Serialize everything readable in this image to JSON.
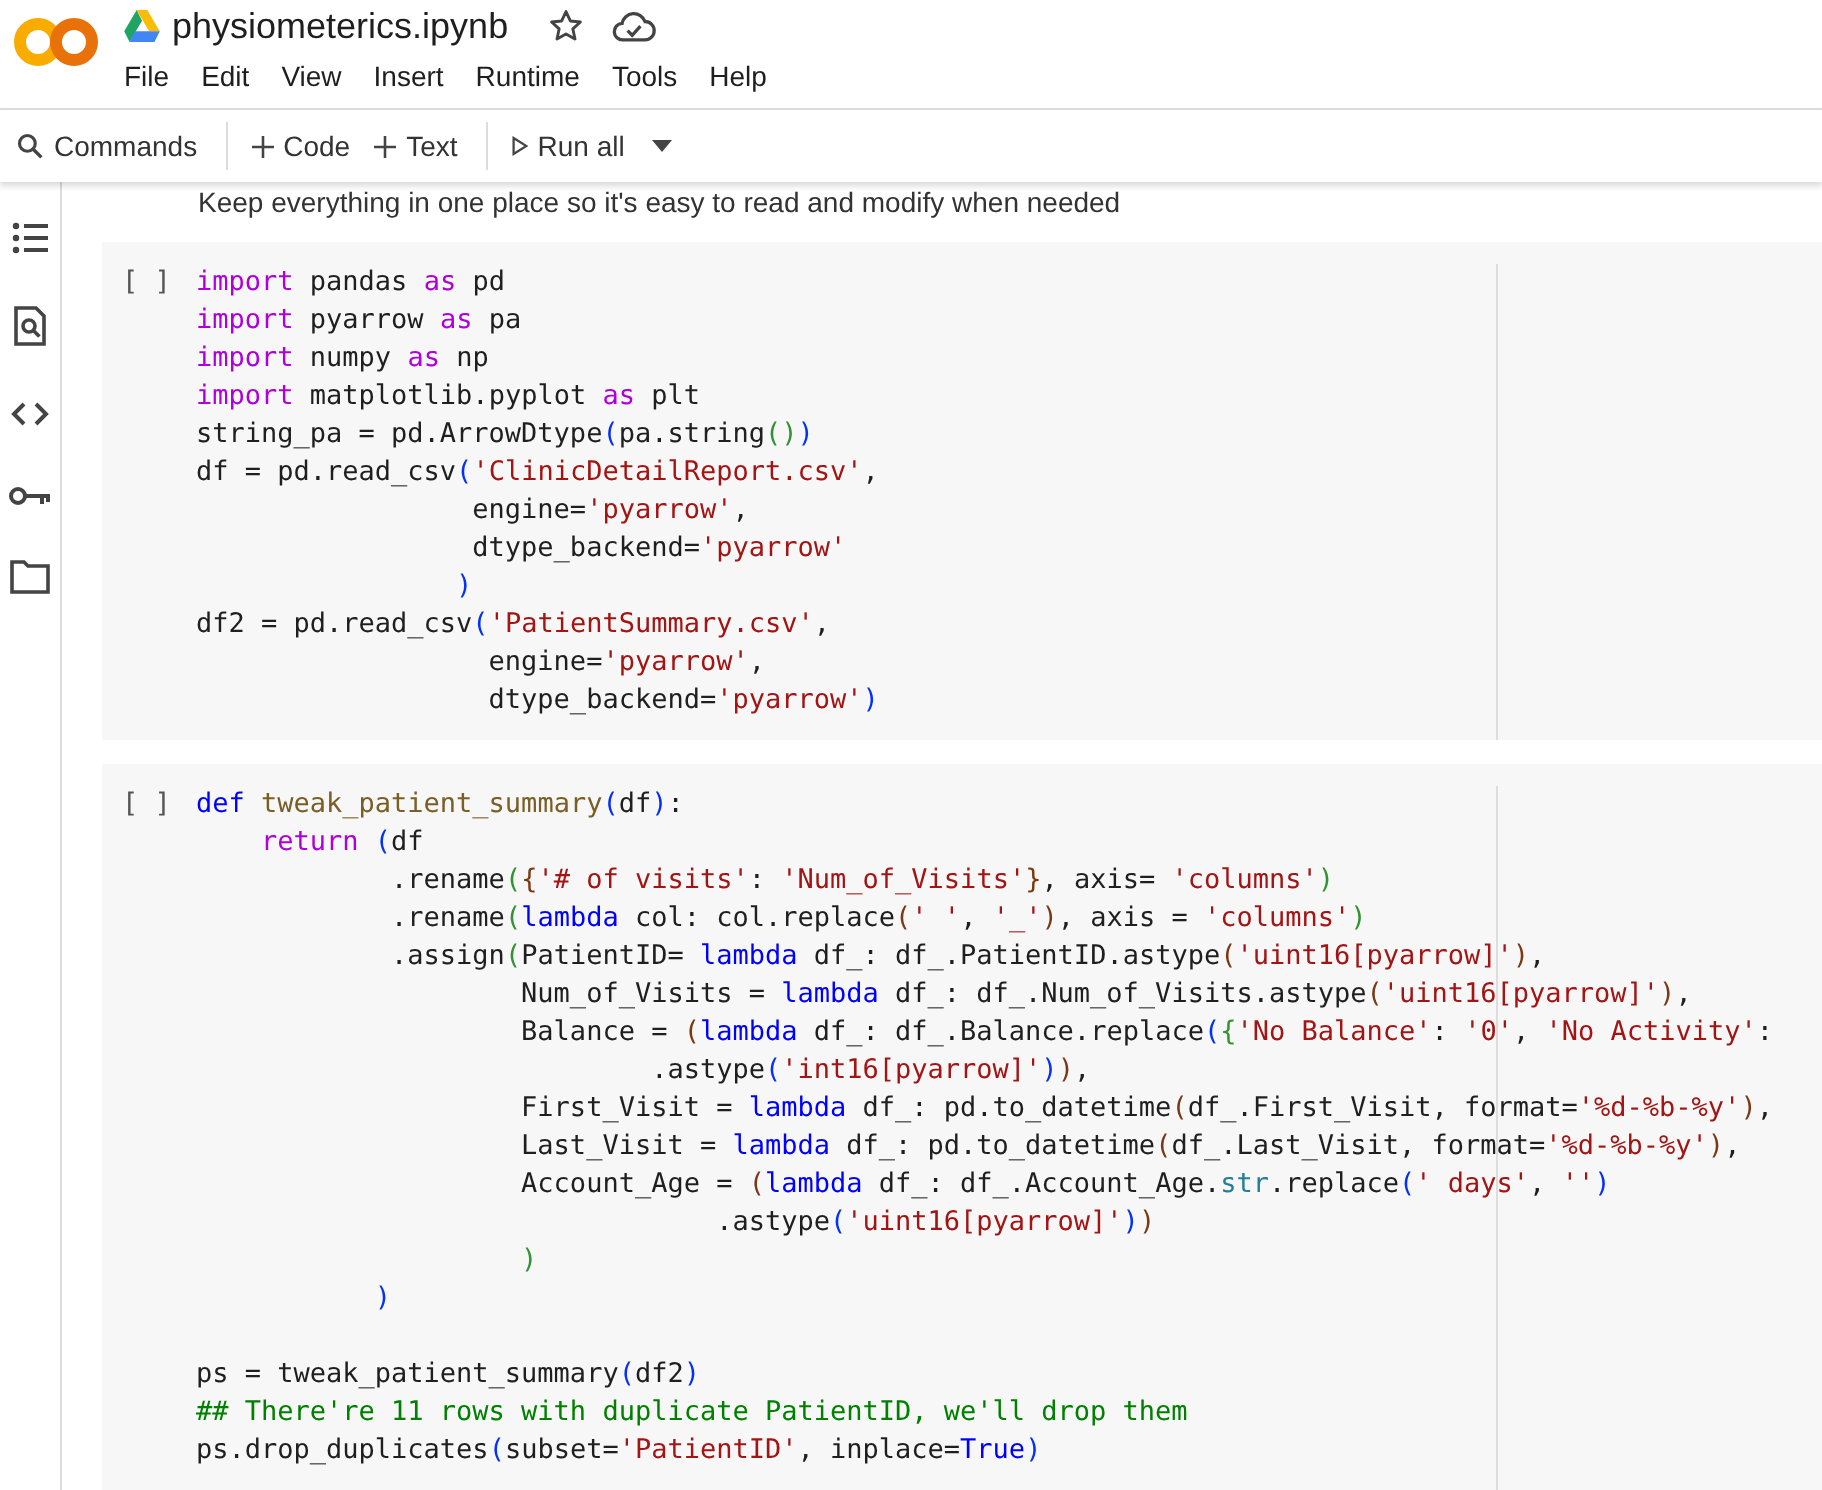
{
  "notebook": {
    "title": "physiometerics.ipynb"
  },
  "menu": [
    "File",
    "Edit",
    "View",
    "Insert",
    "Runtime",
    "Tools",
    "Help"
  ],
  "toolbar": {
    "commands": "Commands",
    "add_code": "Code",
    "add_text": "Text",
    "run_all": "Run all"
  },
  "cells": [
    {
      "kind": "text",
      "text": "Keep everything in one place so it's easy to read and modify when needed"
    },
    {
      "kind": "code",
      "gutter": "[ ]",
      "blocks": [
        [
          [
            {
              "text": "import",
              "kind": "kw"
            },
            {
              "text": " pandas ",
              "kind": "p"
            },
            {
              "text": "as",
              "kind": "kw"
            },
            {
              "text": " pd",
              "kind": "p"
            }
          ],
          [
            {
              "text": "import",
              "kind": "kw"
            },
            {
              "text": " pyarrow ",
              "kind": "p"
            },
            {
              "text": "as",
              "kind": "kw"
            },
            {
              "text": " pa",
              "kind": "p"
            }
          ],
          [
            {
              "text": "import",
              "kind": "kw"
            },
            {
              "text": " numpy ",
              "kind": "p"
            },
            {
              "text": "as",
              "kind": "kw"
            },
            {
              "text": " np",
              "kind": "p"
            }
          ],
          [
            {
              "text": "import",
              "kind": "kw"
            },
            {
              "text": " matplotlib.pyplot ",
              "kind": "p"
            },
            {
              "text": "as",
              "kind": "kw"
            },
            {
              "text": " plt",
              "kind": "p"
            }
          ],
          [
            {
              "text": "string_pa = pd.ArrowDtype",
              "kind": "p"
            },
            {
              "text": "(",
              "kind": "b1"
            },
            {
              "text": "pa.string",
              "kind": "p"
            },
            {
              "text": "()",
              "kind": "b2"
            },
            {
              "text": ")",
              "kind": "b1"
            }
          ],
          [
            {
              "text": "df = pd.read_csv",
              "kind": "p"
            },
            {
              "text": "(",
              "kind": "b1"
            },
            {
              "text": "'ClinicDetailReport.csv'",
              "kind": "s"
            },
            {
              "text": ",",
              "kind": "p"
            }
          ],
          [
            {
              "text": "                 engine=",
              "kind": "p"
            },
            {
              "text": "'pyarrow'",
              "kind": "s"
            },
            {
              "text": ",",
              "kind": "p"
            }
          ],
          [
            {
              "text": "                 dtype_backend=",
              "kind": "p"
            },
            {
              "text": "'pyarrow'",
              "kind": "s"
            }
          ],
          [
            {
              "text": "                )",
              "kind": "b1"
            }
          ],
          [
            {
              "text": "df2 = pd.read_csv",
              "kind": "p"
            },
            {
              "text": "(",
              "kind": "b1"
            },
            {
              "text": "'PatientSummary.csv'",
              "kind": "s"
            },
            {
              "text": ",",
              "kind": "p"
            }
          ],
          [
            {
              "text": "                  engine=",
              "kind": "p"
            },
            {
              "text": "'pyarrow'",
              "kind": "s"
            },
            {
              "text": ",",
              "kind": "p"
            }
          ],
          [
            {
              "text": "                  dtype_backend=",
              "kind": "p"
            },
            {
              "text": "'pyarrow'",
              "kind": "s"
            },
            {
              "text": ")",
              "kind": "b1"
            }
          ]
        ]
      ]
    },
    {
      "kind": "code",
      "gutter": "[ ]",
      "blocks": [
        [
          [
            {
              "text": "def",
              "kind": "bl"
            },
            {
              "text": " tweak_patient_summary",
              "kind": "fn"
            },
            {
              "text": "(",
              "kind": "b1"
            },
            {
              "text": "df",
              "kind": "p"
            },
            {
              "text": ")",
              "kind": "b1"
            },
            {
              "text": ":",
              "kind": "p"
            }
          ],
          [
            {
              "text": "    return",
              "kind": "kw"
            },
            {
              "text": " (",
              "kind": "b1"
            },
            {
              "text": "df",
              "kind": "p"
            }
          ],
          [
            {
              "text": "            .rename",
              "kind": "p"
            },
            {
              "text": "(",
              "kind": "b2"
            },
            {
              "text": "{",
              "kind": "b3"
            },
            {
              "text": "'# of visits'",
              "kind": "s"
            },
            {
              "text": ": ",
              "kind": "p"
            },
            {
              "text": "'Num_of_Visits'",
              "kind": "s"
            },
            {
              "text": "}",
              "kind": "b3"
            },
            {
              "text": ", axis= ",
              "kind": "p"
            },
            {
              "text": "'columns'",
              "kind": "s"
            },
            {
              "text": ")",
              "kind": "b2"
            }
          ],
          [
            {
              "text": "            .rename",
              "kind": "p"
            },
            {
              "text": "(",
              "kind": "b2"
            },
            {
              "text": "lambda",
              "kind": "bl"
            },
            {
              "text": " col: col.replace",
              "kind": "p"
            },
            {
              "text": "(",
              "kind": "b3"
            },
            {
              "text": "' '",
              "kind": "s"
            },
            {
              "text": ", ",
              "kind": "p"
            },
            {
              "text": "'_'",
              "kind": "s"
            },
            {
              "text": ")",
              "kind": "b3"
            },
            {
              "text": ", axis = ",
              "kind": "p"
            },
            {
              "text": "'columns'",
              "kind": "s"
            },
            {
              "text": ")",
              "kind": "b2"
            }
          ],
          [
            {
              "text": "            .assign",
              "kind": "p"
            },
            {
              "text": "(",
              "kind": "b2"
            },
            {
              "text": "PatientID= ",
              "kind": "p"
            },
            {
              "text": "lambda",
              "kind": "bl"
            },
            {
              "text": " df_: df_.PatientID.astype",
              "kind": "p"
            },
            {
              "text": "(",
              "kind": "b3"
            },
            {
              "text": "'uint16[pyarrow]'",
              "kind": "s"
            },
            {
              "text": ")",
              "kind": "b3"
            },
            {
              "text": ",",
              "kind": "p"
            }
          ],
          [
            {
              "text": "                    Num_of_Visits = ",
              "kind": "p"
            },
            {
              "text": "lambda",
              "kind": "bl"
            },
            {
              "text": " df_: df_.Num_of_Visits.astype",
              "kind": "p"
            },
            {
              "text": "(",
              "kind": "b3"
            },
            {
              "text": "'uint16[pyarrow]'",
              "kind": "s"
            },
            {
              "text": ")",
              "kind": "b3"
            },
            {
              "text": ",",
              "kind": "p"
            }
          ],
          [
            {
              "text": "                    Balance = ",
              "kind": "p"
            },
            {
              "text": "(",
              "kind": "b3"
            },
            {
              "text": "lambda",
              "kind": "bl"
            },
            {
              "text": " df_: df_.Balance.replace",
              "kind": "p"
            },
            {
              "text": "(",
              "kind": "b1"
            },
            {
              "text": "{",
              "kind": "b2"
            },
            {
              "text": "'No Balance'",
              "kind": "s"
            },
            {
              "text": ": ",
              "kind": "p"
            },
            {
              "text": "'0'",
              "kind": "s"
            },
            {
              "text": ", ",
              "kind": "p"
            },
            {
              "text": "'No Activity'",
              "kind": "s"
            },
            {
              "text": ":",
              "kind": "p"
            }
          ],
          [
            {
              "text": "                            .astype",
              "kind": "p"
            },
            {
              "text": "(",
              "kind": "b1"
            },
            {
              "text": "'int16[pyarrow]'",
              "kind": "s"
            },
            {
              "text": ")",
              "kind": "b1"
            },
            {
              "text": ")",
              "kind": "b3"
            },
            {
              "text": ",",
              "kind": "p"
            }
          ],
          [
            {
              "text": "                    First_Visit = ",
              "kind": "p"
            },
            {
              "text": "lambda",
              "kind": "bl"
            },
            {
              "text": " df_: pd.to_datetime",
              "kind": "p"
            },
            {
              "text": "(",
              "kind": "b3"
            },
            {
              "text": "df_.First_Visit, format=",
              "kind": "p"
            },
            {
              "text": "'%d-%b-%y'",
              "kind": "s"
            },
            {
              "text": ")",
              "kind": "b3"
            },
            {
              "text": ",",
              "kind": "p"
            }
          ],
          [
            {
              "text": "                    Last_Visit = ",
              "kind": "p"
            },
            {
              "text": "lambda",
              "kind": "bl"
            },
            {
              "text": " df_: pd.to_datetime",
              "kind": "p"
            },
            {
              "text": "(",
              "kind": "b3"
            },
            {
              "text": "df_.Last_Visit, format=",
              "kind": "p"
            },
            {
              "text": "'%d-%b-%y'",
              "kind": "s"
            },
            {
              "text": ")",
              "kind": "b3"
            },
            {
              "text": ",",
              "kind": "p"
            }
          ],
          [
            {
              "text": "                    Account_Age = ",
              "kind": "p"
            },
            {
              "text": "(",
              "kind": "b3"
            },
            {
              "text": "lambda",
              "kind": "bl"
            },
            {
              "text": " df_: df_.Account_Age.",
              "kind": "p"
            },
            {
              "text": "str",
              "kind": "t"
            },
            {
              "text": ".replace",
              "kind": "p"
            },
            {
              "text": "(",
              "kind": "b1"
            },
            {
              "text": "' days'",
              "kind": "s"
            },
            {
              "text": ", ",
              "kind": "p"
            },
            {
              "text": "''",
              "kind": "s"
            },
            {
              "text": ")",
              "kind": "b1"
            }
          ],
          [
            {
              "text": "                                .astype",
              "kind": "p"
            },
            {
              "text": "(",
              "kind": "b1"
            },
            {
              "text": "'uint16[pyarrow]'",
              "kind": "s"
            },
            {
              "text": ")",
              "kind": "b1"
            },
            {
              "text": ")",
              "kind": "b3"
            }
          ],
          [
            {
              "text": "                    )",
              "kind": "b2"
            }
          ],
          [
            {
              "text": "           )",
              "kind": "b1"
            }
          ]
        ],
        [
          [
            {
              "text": "ps = tweak_patient_summary",
              "kind": "p"
            },
            {
              "text": "(",
              "kind": "b1"
            },
            {
              "text": "df2",
              "kind": "p"
            },
            {
              "text": ")",
              "kind": "b1"
            }
          ],
          [
            {
              "text": "## There're 11 rows with duplicate PatientID, we'll drop them",
              "kind": "c"
            }
          ],
          [
            {
              "text": "ps.drop_duplicates",
              "kind": "p"
            },
            {
              "text": "(",
              "kind": "b1"
            },
            {
              "text": "subset=",
              "kind": "p"
            },
            {
              "text": "'PatientID'",
              "kind": "s"
            },
            {
              "text": ", inplace=",
              "kind": "p"
            },
            {
              "text": "True",
              "kind": "bl"
            },
            {
              "text": ")",
              "kind": "b1"
            }
          ]
        ]
      ]
    }
  ]
}
